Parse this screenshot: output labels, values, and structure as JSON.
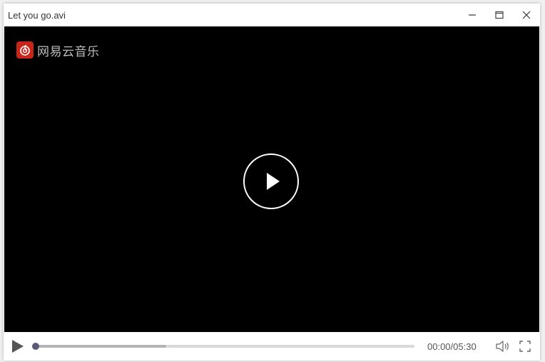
{
  "window": {
    "title": "Let you go.avi",
    "controls": {
      "minimize": "minimize-icon",
      "maximize": "maximize-icon",
      "close": "close-icon"
    }
  },
  "video": {
    "brand_text": "网易云音乐",
    "brand_icon": "netease-music-logo-icon",
    "brand_color": "#c8261b",
    "center_icon": "play-circle-icon"
  },
  "player": {
    "play_icon": "play-icon",
    "time_display": "00:00/05:30",
    "progress_fraction": 0,
    "buffered_fraction": 0.35,
    "volume_icon": "volume-icon",
    "fullscreen_icon": "fullscreen-icon",
    "accent_color": "#5a5a78"
  }
}
